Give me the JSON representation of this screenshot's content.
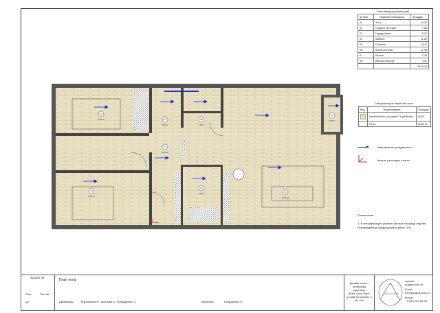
{
  "rooms_table": {
    "title": "Экспликация помещений",
    "headers": [
      "№ Пом.",
      "Название помещения",
      "Площадь"
    ],
    "rows": [
      [
        "01",
        "Холл",
        "10,20"
      ],
      [
        "02",
        "Санузел гостевой",
        "7,86"
      ],
      [
        "03",
        "Гардеробная",
        "5,22"
      ],
      [
        "04",
        "Кабинет",
        "12,62"
      ],
      [
        "05",
        "Спальня",
        "15,41"
      ],
      [
        "06",
        "Кухня-гостиная",
        "31,98"
      ],
      [
        "07",
        "Балкон",
        "2,45"
      ],
      [
        "08",
        "Ванная комната",
        "3,52"
      ]
    ],
    "total": "83,26 м²"
  },
  "floor_table": {
    "title": "Спецификация покрытий пола",
    "headers": [
      "Вид",
      "Наименование",
      "Площадь"
    ],
    "rows": [
      [
        "",
        "Керамогранит под паркет \"в разбежку\"",
        "83,82"
      ]
    ],
    "total_label": "Итого",
    "total": "83,82 м²"
  },
  "legend": {
    "arrow_label": "Направление укладки пола",
    "start_label": "Начало раскладки плитки"
  },
  "notes": {
    "title": "Примечание:",
    "line1": "1. В спецификации указаны чистые площади отделки.",
    "line2": "Рекомендуется предусмотреть запас 10%."
  },
  "plan_labels": [
    {
      "num": "05",
      "area": "15,41 м²"
    },
    {
      "num": "03",
      "area": "5,22 м²"
    },
    {
      "num": "08",
      "area": "3,52 м²"
    },
    {
      "num": "01",
      "area": "10,20 м²"
    },
    {
      "num": "04",
      "area": "12,62 м²"
    },
    {
      "num": "02",
      "area": "7,86 м²"
    },
    {
      "num": "06",
      "area": "31,98 м²"
    },
    {
      "num": "07",
      "area": "2,45 м²"
    }
  ],
  "title_block": {
    "format": "Формат А3",
    "sheet_label": "Лист",
    "sheets_label": "Листов",
    "sheet_code": "АР",
    "sheet_title": "План пола",
    "designers_label": "Дизайнеры:",
    "designers": "Мурашкина В., Шатлова В., Бондаренко О.",
    "checked_label": "Проверил:",
    "checked": "Бондаренко О.",
    "project_lines": [
      "Дизайн-проект",
      "интерьера",
      "квартиры",
      "в ЖК Сити Парк",
      "ул.Мантулинская, 9",
      "кв. 190"
    ],
    "website_label": "website:",
    "website": "august-buro.ru",
    "email_label": "Email:",
    "email": "info@august-buro.ru",
    "phone_label": "phone:",
    "phone": "+7-926-787-55-05"
  },
  "colors": {
    "arrow": "#1a2bd6",
    "start_mark": "#d42020",
    "wood": "#eae2c6",
    "plank_line": "#b8ab7e"
  }
}
